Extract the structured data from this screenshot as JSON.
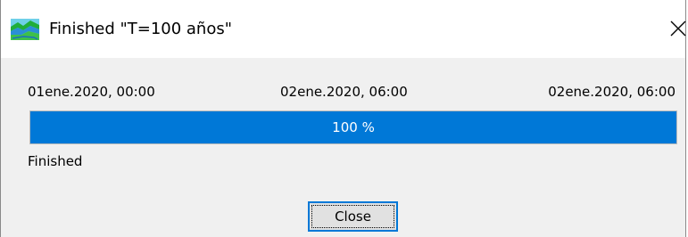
{
  "window": {
    "title": "Finished \"T=100 años\"",
    "icon": "landscape-app-icon",
    "close_icon": "close-icon"
  },
  "timeline": {
    "start": "01ene.2020, 00:00",
    "current": "02ene.2020, 06:00",
    "end": "02ene.2020, 06:00"
  },
  "progress": {
    "value_percent": 100,
    "label": "100 %",
    "fill_color": "#0078d7"
  },
  "status": {
    "text": "Finished"
  },
  "buttons": {
    "close_label": "Close"
  }
}
